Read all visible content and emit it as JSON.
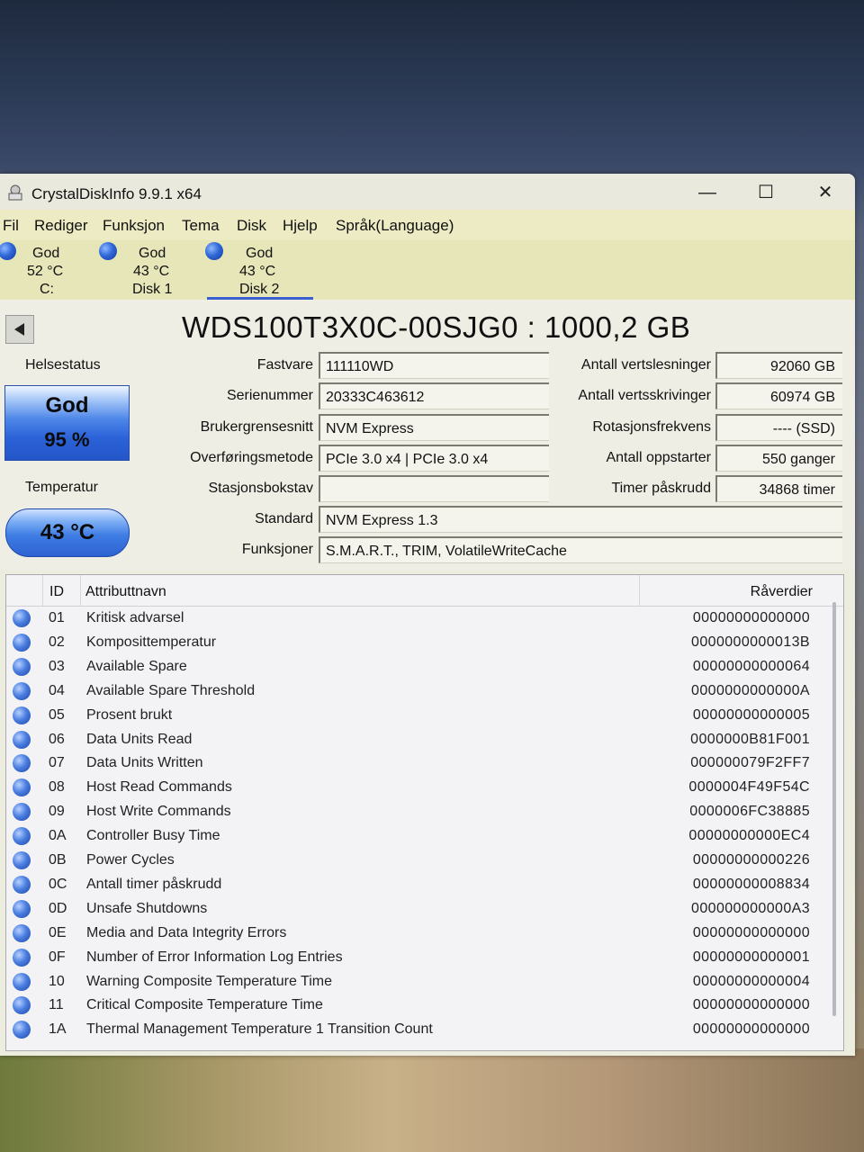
{
  "app": {
    "title": "CrystalDiskInfo 9.9.1 x64"
  },
  "window_controls": {
    "minimize": "—",
    "maximize": "☐",
    "close": "✕"
  },
  "menu": [
    "Fil",
    "Rediger",
    "Funksjon",
    "Tema",
    "Disk",
    "Hjelp",
    "Språk(Language)"
  ],
  "disks": [
    {
      "status": "God",
      "temp": "52 °C",
      "name": "C:"
    },
    {
      "status": "God",
      "temp": "43 °C",
      "name": "Disk 1"
    },
    {
      "status": "God",
      "temp": "43 °C",
      "name": "Disk 2"
    }
  ],
  "model": "WDS100T3X0C-00SJG0 : 1000,2 GB",
  "health": {
    "label": "Helsestatus",
    "status": "God",
    "percent": "95 %",
    "color": "#2c62d8"
  },
  "temperature": {
    "label": "Temperatur",
    "value": "43 °C"
  },
  "fields_left": [
    {
      "label": "Fastvare",
      "value": "111110WD"
    },
    {
      "label": "Serienummer",
      "value": "20333C463612"
    },
    {
      "label": "Brukergrensesnitt",
      "value": "NVM Express"
    },
    {
      "label": "Overføringsmetode",
      "value": "PCIe 3.0 x4 | PCIe 3.0 x4"
    },
    {
      "label": "Stasjonsbokstav",
      "value": ""
    }
  ],
  "fields_right": [
    {
      "label": "Antall vertslesninger",
      "value": "92060 GB"
    },
    {
      "label": "Antall vertsskrivinger",
      "value": "60974 GB"
    },
    {
      "label": "Rotasjonsfrekvens",
      "value": "---- (SSD)"
    },
    {
      "label": "Antall oppstarter",
      "value": "550 ganger"
    },
    {
      "label": "Timer påskrudd",
      "value": "34868 timer"
    }
  ],
  "standard": {
    "label": "Standard",
    "value": "NVM Express 1.3"
  },
  "features": {
    "label": "Funksjoner",
    "value": "S.M.A.R.T., TRIM, VolatileWriteCache"
  },
  "table": {
    "headers": {
      "id": "ID",
      "name": "Attributtnavn",
      "raw": "Råverdier"
    },
    "rows": [
      {
        "id": "01",
        "name": "Kritisk advarsel",
        "raw": "00000000000000"
      },
      {
        "id": "02",
        "name": "Komposittemperatur",
        "raw": "0000000000013B"
      },
      {
        "id": "03",
        "name": "Available Spare",
        "raw": "00000000000064"
      },
      {
        "id": "04",
        "name": "Available Spare Threshold",
        "raw": "0000000000000A"
      },
      {
        "id": "05",
        "name": "Prosent brukt",
        "raw": "00000000000005"
      },
      {
        "id": "06",
        "name": "Data Units Read",
        "raw": "0000000B81F001"
      },
      {
        "id": "07",
        "name": "Data Units Written",
        "raw": "000000079F2FF7"
      },
      {
        "id": "08",
        "name": "Host Read Commands",
        "raw": "0000004F49F54C"
      },
      {
        "id": "09",
        "name": "Host Write Commands",
        "raw": "0000006FC38885"
      },
      {
        "id": "0A",
        "name": "Controller Busy Time",
        "raw": "00000000000EC4"
      },
      {
        "id": "0B",
        "name": "Power Cycles",
        "raw": "00000000000226"
      },
      {
        "id": "0C",
        "name": "Antall timer påskrudd",
        "raw": "00000000008834"
      },
      {
        "id": "0D",
        "name": "Unsafe Shutdowns",
        "raw": "000000000000A3"
      },
      {
        "id": "0E",
        "name": "Media and Data Integrity Errors",
        "raw": "00000000000000"
      },
      {
        "id": "0F",
        "name": "Number of Error Information Log Entries",
        "raw": "00000000000001"
      },
      {
        "id": "10",
        "name": "Warning Composite Temperature Time",
        "raw": "00000000000004"
      },
      {
        "id": "11",
        "name": "Critical Composite Temperature Time",
        "raw": "00000000000000"
      },
      {
        "id": "1A",
        "name": "Thermal Management Temperature 1 Transition Count",
        "raw": "00000000000000"
      }
    ]
  }
}
